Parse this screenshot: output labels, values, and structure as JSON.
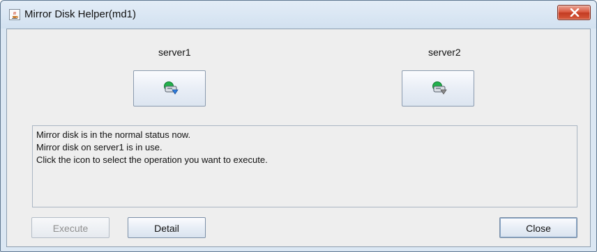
{
  "window": {
    "title": "Mirror Disk Helper(md1)",
    "icon": "java-cup-icon",
    "close_icon": "close-x-icon"
  },
  "servers": [
    {
      "label": "server1",
      "icon": "mirror-disk-active-icon",
      "status_color": "#2f7fe0"
    },
    {
      "label": "server2",
      "icon": "mirror-disk-standby-icon",
      "status_color": "#8c8c8c"
    }
  ],
  "message": {
    "lines": [
      "Mirror disk is in the normal status now.",
      "Mirror disk on server1 is in use.",
      "Click the icon to select the operation you want to execute."
    ]
  },
  "buttons": {
    "execute": "Execute",
    "detail": "Detail",
    "close": "Close"
  }
}
